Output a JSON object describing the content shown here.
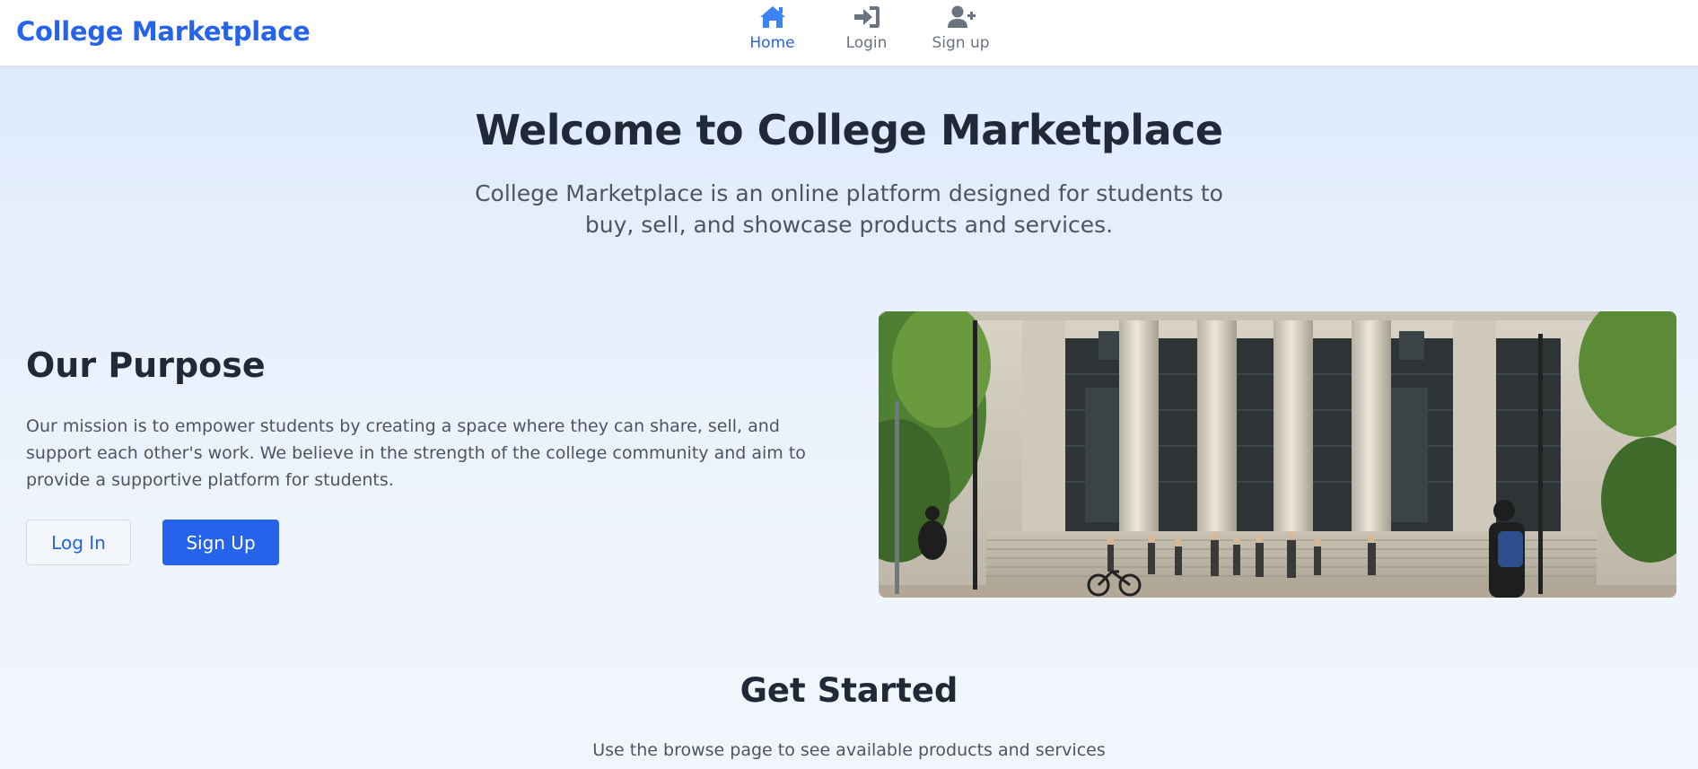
{
  "header": {
    "brand": "College Marketplace",
    "nav": [
      {
        "label": "Home",
        "icon": "home-icon",
        "active": true
      },
      {
        "label": "Login",
        "icon": "login-icon",
        "active": false
      },
      {
        "label": "Sign up",
        "icon": "user-plus-icon",
        "active": false
      }
    ]
  },
  "hero": {
    "title": "Welcome to College Marketplace",
    "subtitle": "College Marketplace is an online platform designed for students to buy, sell, and showcase products and services."
  },
  "purpose": {
    "title": "Our Purpose",
    "text": "Our mission is to empower students by creating a space where they can share, sell, and support each other's work. We believe in the strength of the college community and aim to provide a supportive platform for students.",
    "login_button": "Log In",
    "signup_button": "Sign Up"
  },
  "get_started": {
    "title": "Get Started",
    "text": "Use the browse page to see available products and services"
  },
  "colors": {
    "accent": "#2563eb",
    "text_dark": "#1f2937",
    "text_muted": "#4b5563",
    "nav_inactive": "#6b7280"
  }
}
